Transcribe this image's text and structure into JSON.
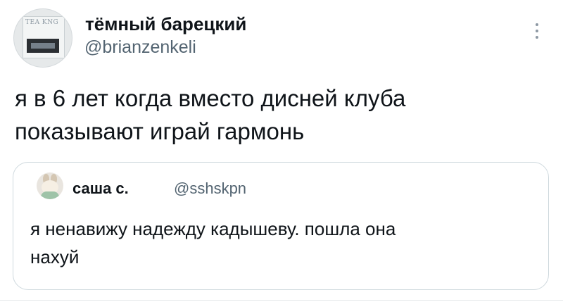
{
  "author": {
    "display_name": "тёмный барецкий",
    "handle": "@brianzenkeli",
    "avatar_icon": "profile-avatar",
    "avatar_text": "TEA KNG"
  },
  "tweet": {
    "text_line1": "я в 6 лет когда вместо дисней клуба",
    "text_line2": "показывают играй гармонь"
  },
  "quoted": {
    "display_name": "саша с.",
    "handle": "@sshskpn",
    "text_line1": "я ненавижу надежду кадышеву. пошла она",
    "text_line2": "нахуй"
  },
  "menu": {
    "icon": "more-vertical-icon"
  }
}
